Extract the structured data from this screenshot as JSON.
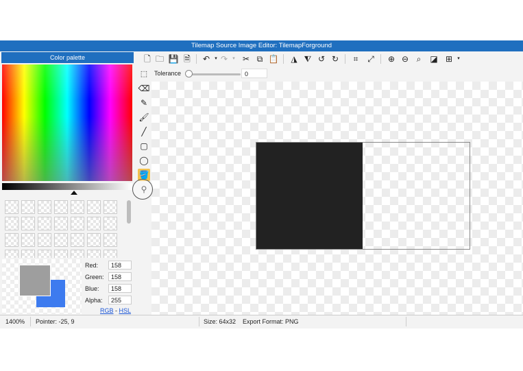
{
  "window": {
    "title": "Tilemap Source Image Editor: TilemapForground"
  },
  "palette": {
    "header": "Color palette",
    "red_label": "Red:",
    "red": "158",
    "green_label": "Green:",
    "green": "158",
    "blue_label": "Blue:",
    "blue": "158",
    "alpha_label": "Alpha:",
    "alpha": "255",
    "rgb_link": "RGB",
    "separator": " - ",
    "hsl_link": "HSL",
    "primary_color": "#9e9e9e",
    "secondary_color": "#3d7bef"
  },
  "options": {
    "tolerance_label": "Tolerance",
    "tolerance_value": "0"
  },
  "status": {
    "zoom": "1400%",
    "pointer": "Pointer: -25, 9",
    "size": "Size: 64x32",
    "export_format": "Export Format: PNG"
  },
  "toolbar_icons": [
    "new-file-icon",
    "open-folder-icon",
    "save-icon",
    "save-as-icon",
    "undo-icon",
    "redo-icon",
    "cut-icon",
    "copy-icon",
    "paste-icon",
    "flip-horizontal-icon",
    "flip-vertical-icon",
    "rotate-left-icon",
    "rotate-right-icon",
    "crop-icon",
    "resize-icon",
    "zoom-in-icon",
    "zoom-out-icon",
    "zoom-fit-icon",
    "invert-colors-icon",
    "grid-icon"
  ],
  "tools": [
    "select-tool",
    "eraser-tool",
    "pencil-tool",
    "brush-tool",
    "line-tool",
    "rectangle-tool",
    "ellipse-tool",
    "fill-tool",
    "eyedropper-tool"
  ],
  "active_tool": "fill-tool"
}
